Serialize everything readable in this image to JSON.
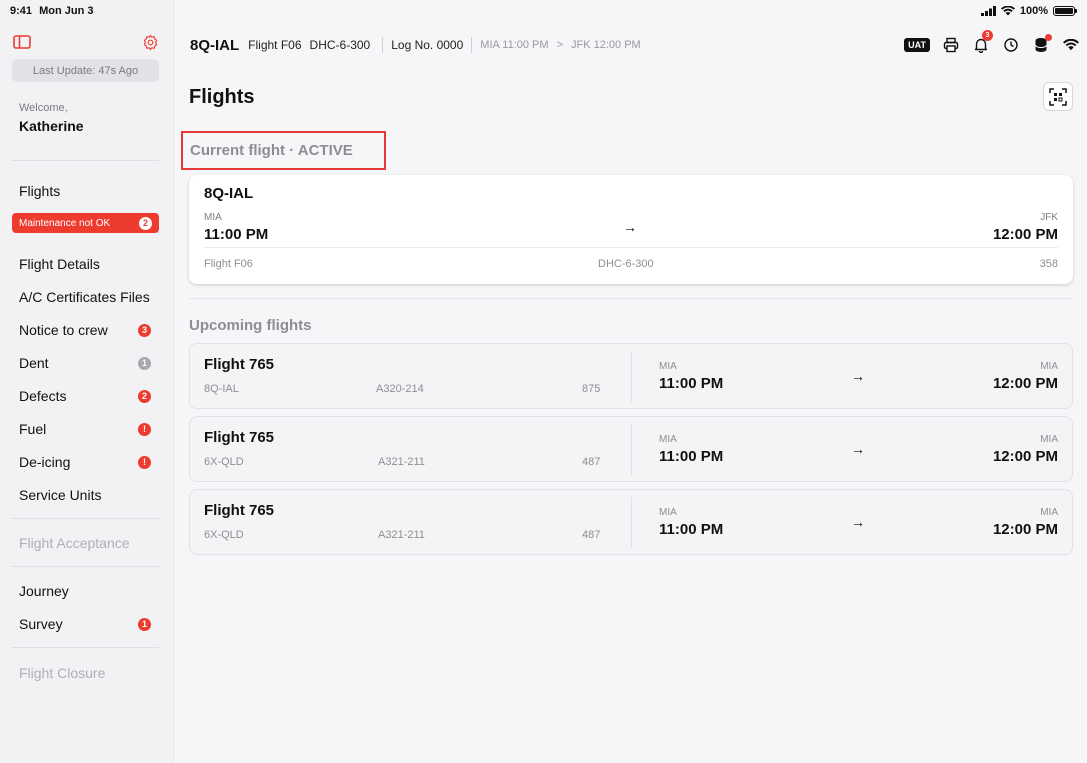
{
  "status_bar": {
    "time": "9:41",
    "date": "Mon Jun 3",
    "battery": "100%"
  },
  "sidebar": {
    "last_update": "Last Update: 47s Ago",
    "welcome": "Welcome,",
    "username": "Katherine",
    "flights": "Flights",
    "maintenance_banner": {
      "label": "Maintenance not OK",
      "count": "2"
    },
    "items": [
      {
        "label": "Flight Details",
        "badge": ""
      },
      {
        "label": "A/C Certificates Files",
        "badge": ""
      },
      {
        "label": "Notice to crew",
        "badge": "3"
      },
      {
        "label": "Dent",
        "badge": "1"
      },
      {
        "label": "Defects",
        "badge": "2"
      },
      {
        "label": "Fuel",
        "badge": "!"
      },
      {
        "label": "De-icing",
        "badge": "!"
      },
      {
        "label": "Service Units",
        "badge": ""
      }
    ],
    "flight_acceptance": "Flight Acceptance",
    "journey": "Journey",
    "survey": {
      "label": "Survey",
      "badge": "1"
    },
    "flight_closure": "Flight Closure"
  },
  "header": {
    "registration": "8Q-IAL",
    "flight": "Flight F06",
    "aircraft_type": "DHC-6-300",
    "log_no": "Log No. 0000",
    "route_from": "MIA 11:00 PM",
    "route_sep": ">",
    "route_to": "JFK 12:00 PM",
    "uat": "UAT",
    "notification_count": "3"
  },
  "page_title": "Flights",
  "current_flight": {
    "label": "Current flight  ·  ACTIVE",
    "registration": "8Q-IAL",
    "from_code": "MIA",
    "from_time": "11:00 PM",
    "to_code": "JFK",
    "to_time": "12:00 PM",
    "flight": "Flight F06",
    "aircraft_type": "DHC-6-300",
    "number": "358"
  },
  "upcoming_label": "Upcoming flights",
  "upcoming": [
    {
      "title": "Flight 765",
      "registration": "8Q-IAL",
      "type": "A320-214",
      "number": "875",
      "from_code": "MIA",
      "from_time": "11:00 PM",
      "to_code": "MIA",
      "to_time": "12:00 PM"
    },
    {
      "title": "Flight 765",
      "registration": "6X-QLD",
      "type": "A321-211",
      "number": "487",
      "from_code": "MIA",
      "from_time": "11:00 PM",
      "to_code": "MIA",
      "to_time": "12:00 PM"
    },
    {
      "title": "Flight 765",
      "registration": "6X-QLD",
      "type": "A321-211",
      "number": "487",
      "from_code": "MIA",
      "from_time": "11:00 PM",
      "to_code": "MIA",
      "to_time": "12:00 PM"
    }
  ],
  "arrow": "→",
  "colors": {
    "alert_red": "#ee3b2f",
    "highlight_border": "#e53935"
  }
}
